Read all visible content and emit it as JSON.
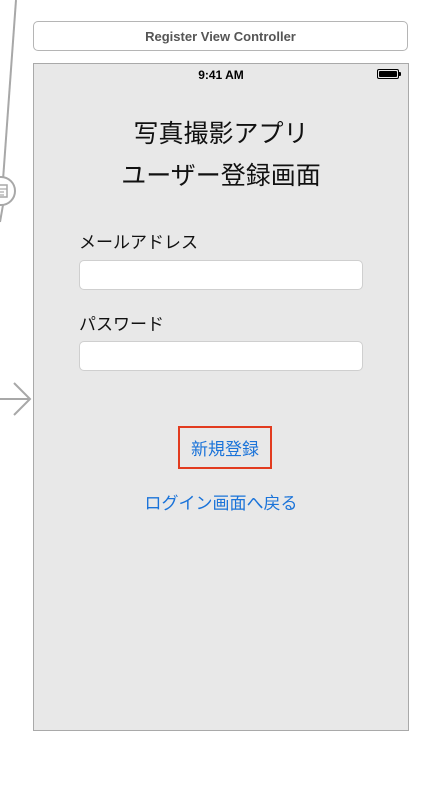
{
  "scene": {
    "title": "Register View Controller"
  },
  "status_bar": {
    "time": "9:41 AM"
  },
  "screen": {
    "title_line_1": "写真撮影アプリ",
    "title_line_2": "ユーザー登録画面",
    "email_label": "メールアドレス",
    "email_value": "",
    "password_label": "パスワード",
    "password_value": "",
    "register_button": "新規登録",
    "back_link": "ログイン画面へ戻る"
  },
  "colors": {
    "link_blue": "#1a73d9",
    "selection_red": "#e23b1f",
    "device_background": "#e8e8e8"
  },
  "icons": {
    "segue": "segue-icon",
    "entry": "entry-arrow-icon",
    "battery": "battery-icon"
  }
}
